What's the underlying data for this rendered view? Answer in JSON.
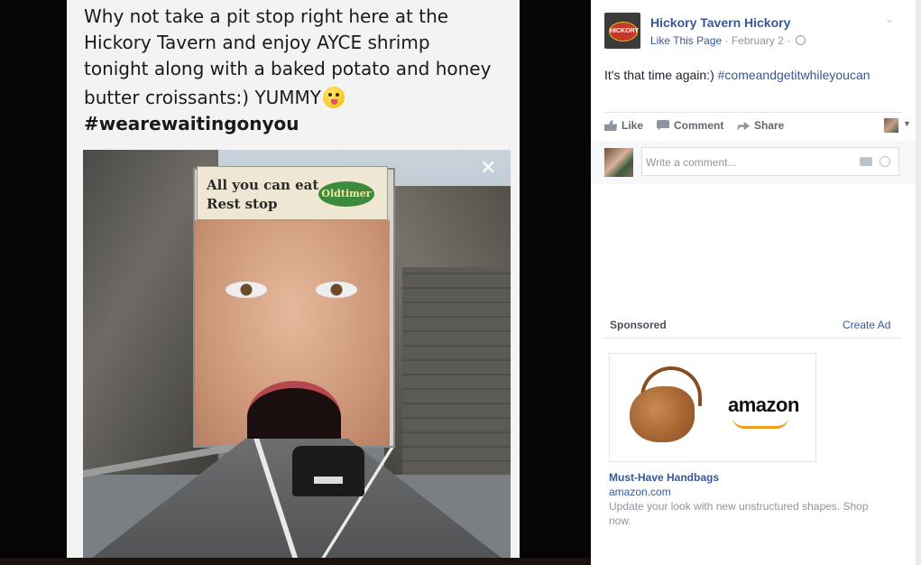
{
  "photo": {
    "caption": "Why not take a pit stop right here at the\nHickory Tavern and enjoy AYCE shrimp\ntonight along with a baked potato and honey\nbutter croissants:) YUMMY",
    "hashtag": "#wearewaitingonyou",
    "emoji_icon": "winking-tongue-emoji-icon",
    "close_icon": "✕",
    "billboard": {
      "line1": "All you can eat\nRest stop",
      "brand": "Oldtimer"
    }
  },
  "post": {
    "page_name": "Hickory Tavern Hickory",
    "avatar_text": "HICKORY",
    "like_page": "Like This Page",
    "date": "· February 2 ·",
    "text": "It's that time again:) ",
    "hashtag": "#comeandgetitwhileyoucan",
    "actions": {
      "like": "Like",
      "comment": "Comment",
      "share": "Share"
    },
    "comment_placeholder": "Write a comment..."
  },
  "sidebar": {
    "sponsored_label": "Sponsored",
    "create_ad": "Create Ad",
    "ad": {
      "brand": "amazon",
      "title": "Must-Have Handbags",
      "domain": "amazon.com",
      "description": "Update your look with new unstructured shapes. Shop now."
    }
  },
  "colors": {
    "link": "#365899",
    "muted": "#90949c",
    "text": "#1d2129"
  }
}
